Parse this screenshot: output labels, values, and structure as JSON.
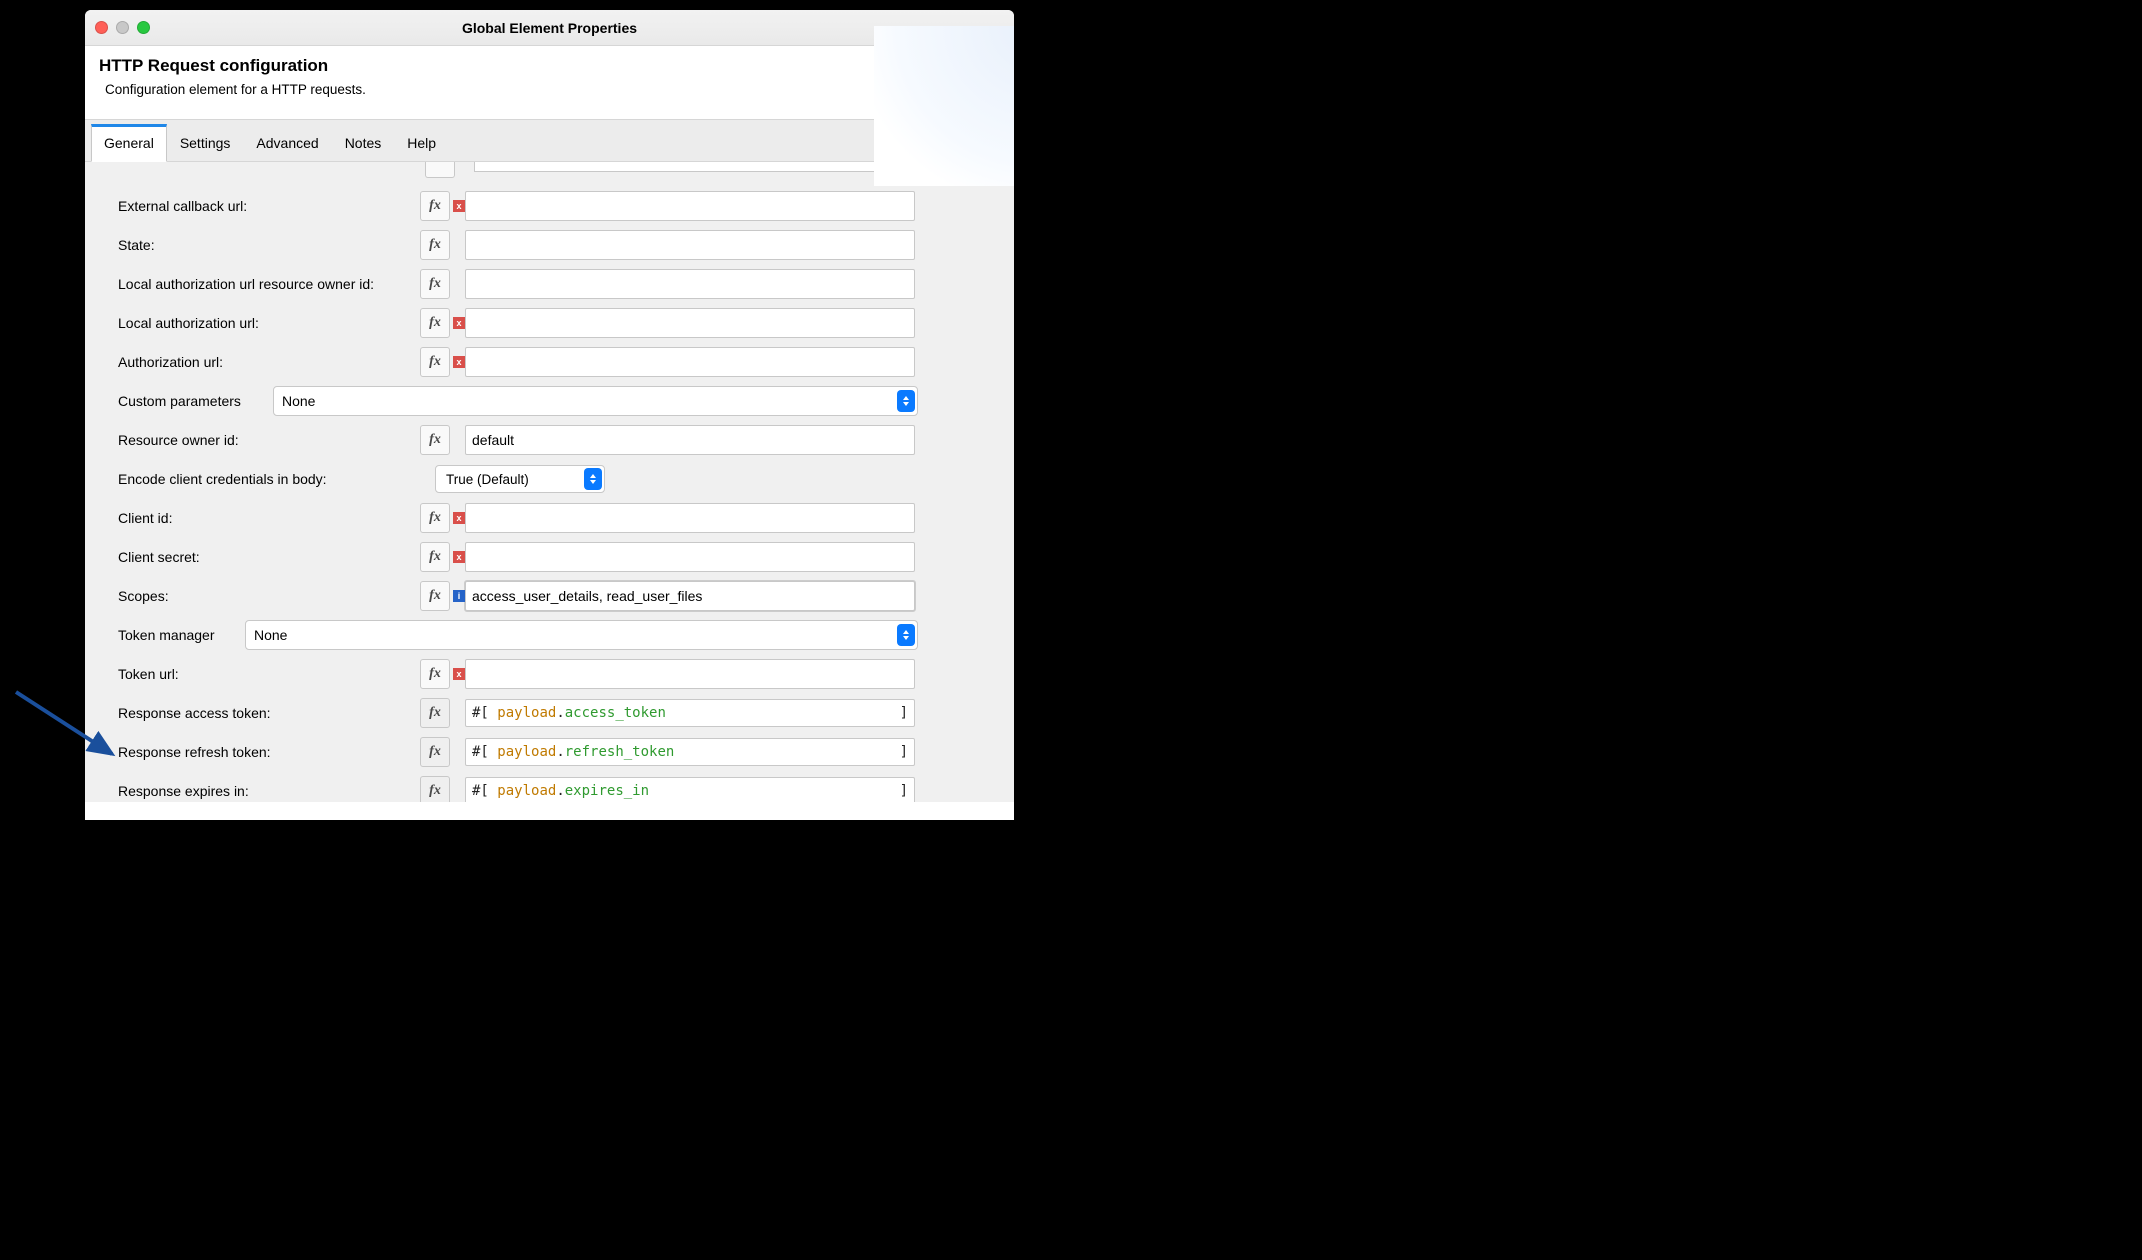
{
  "window": {
    "title": "Global Element Properties"
  },
  "header": {
    "title": "HTTP Request configuration",
    "subtitle": "Configuration element for a HTTP requests."
  },
  "tabs": {
    "general": "General",
    "settings": "Settings",
    "advanced": "Advanced",
    "notes": "Notes",
    "help": "Help"
  },
  "labels": {
    "external_callback_url": "External callback url:",
    "state": "State:",
    "local_auth_url_ro_id": "Local authorization url resource owner id:",
    "local_auth_url": "Local authorization url:",
    "authorization_url": "Authorization url:",
    "custom_parameters": "Custom parameters",
    "resource_owner_id": "Resource owner id:",
    "encode_client_credentials": "Encode client credentials in body:",
    "client_id": "Client id:",
    "client_secret": "Client secret:",
    "scopes": "Scopes:",
    "token_manager": "Token manager",
    "token_url": "Token url:",
    "response_access_token": "Response access token:",
    "response_refresh_token": "Response refresh token:",
    "response_expires_in": "Response expires in:"
  },
  "values": {
    "custom_parameters": "None",
    "resource_owner_id": "default",
    "encode_client_credentials": "True (Default)",
    "scopes": "access_user_details, read_user_files",
    "token_manager": "None"
  },
  "expr": {
    "open": "#[ ",
    "close": "]",
    "payload": "payload",
    "dot": ".",
    "access_token": "access_token",
    "refresh_token": "refresh_token",
    "expires_in": "expires_in"
  },
  "fx": "fx",
  "badges": {
    "error": "x",
    "info": "i"
  }
}
